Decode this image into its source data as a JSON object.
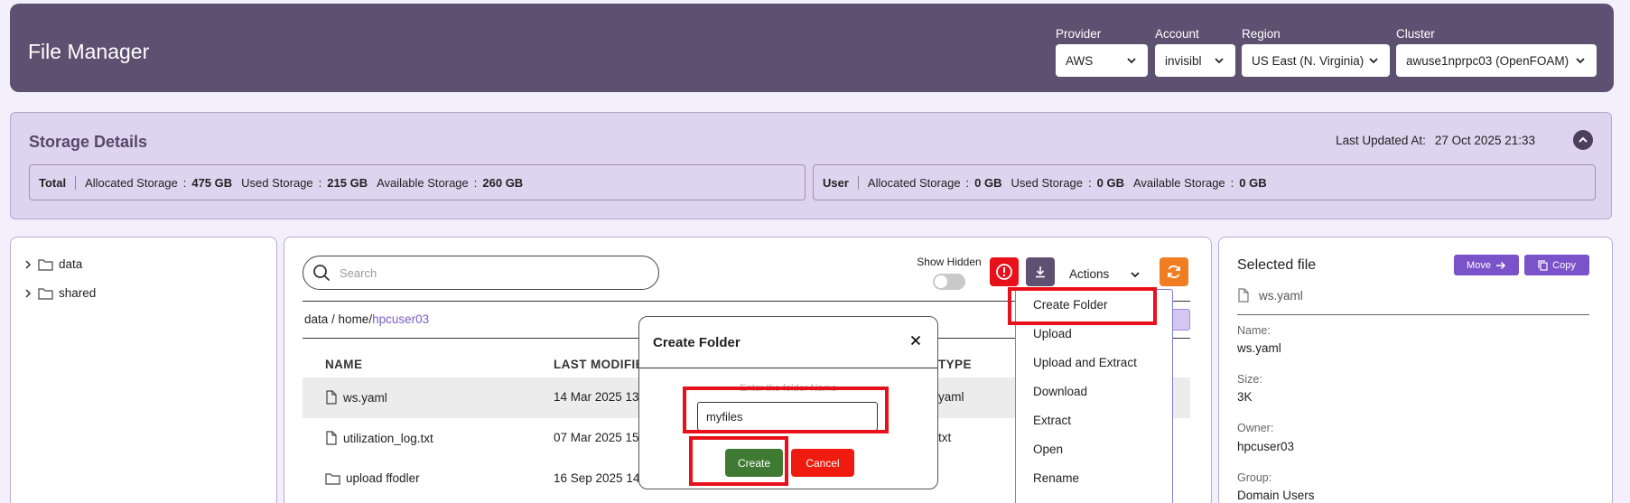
{
  "header": {
    "title": "File Manager",
    "provider": {
      "label": "Provider",
      "value": "AWS"
    },
    "account": {
      "label": "Account",
      "value": "invisibl"
    },
    "region": {
      "label": "Region",
      "value": "US East (N. Virginia)"
    },
    "cluster": {
      "label": "Cluster",
      "value": "awuse1nprpc03 (OpenFOAM)"
    }
  },
  "storage": {
    "title": "Storage Details",
    "last_updated_label": "Last Updated At:",
    "last_updated_value": "27 Oct 2025 21:33",
    "total": {
      "kind": "Total",
      "allocated_label": "Allocated Storage",
      "allocated": "475 GB",
      "used_label": "Used Storage",
      "used": "215 GB",
      "available_label": "Available Storage",
      "available": "260 GB"
    },
    "user": {
      "kind": "User",
      "allocated_label": "Allocated Storage",
      "allocated": "0 GB",
      "used_label": "Used Storage",
      "used": "0 GB",
      "available_label": "Available Storage",
      "available": "0 GB"
    },
    "separator": ":"
  },
  "tree": {
    "items": [
      {
        "label": "data"
      },
      {
        "label": "shared"
      }
    ]
  },
  "files": {
    "search_placeholder": "Search",
    "show_hidden_label": "Show Hidden",
    "actions_label": "Actions",
    "breadcrumb": {
      "root": "data",
      "sep": " / ",
      "mid": "home/",
      "current": "hpcuser03"
    },
    "columns": {
      "name": "NAME",
      "modified": "LAST MODIFIE",
      "type": "TYPE"
    },
    "rows": [
      {
        "name": "ws.yaml",
        "modified": "14 Mar 2025 13:",
        "type": "yaml"
      },
      {
        "name": "utilization_log.txt",
        "modified": "07 Mar 2025 15:",
        "type": "txt"
      },
      {
        "name": "upload ffodler",
        "modified": "16 Sep 2025 14:",
        "type": ""
      }
    ]
  },
  "actions_menu": [
    "Create Folder",
    "Upload",
    "Upload and Extract",
    "Download",
    "Extract",
    "Open",
    "Rename"
  ],
  "modal": {
    "title": "Create Folder",
    "label": "Enter the folder Name",
    "input_value": "myfiles",
    "create_label": "Create",
    "cancel_label": "Cancel"
  },
  "selected_file": {
    "title": "Selected file",
    "move_label": "Move",
    "copy_label": "Copy",
    "file": "ws.yaml",
    "name_label": "Name:",
    "name": "ws.yaml",
    "size_label": "Size:",
    "size": "3K",
    "owner_label": "Owner:",
    "owner": "hpcuser03",
    "group_label": "Group:",
    "group": "Domain Users"
  },
  "colors": {
    "header_bg": "#5e5071",
    "accent_purple": "#7a52c9",
    "danger_red": "#e8101a",
    "create_green": "#3f7a32",
    "refresh_orange": "#f07d22"
  }
}
